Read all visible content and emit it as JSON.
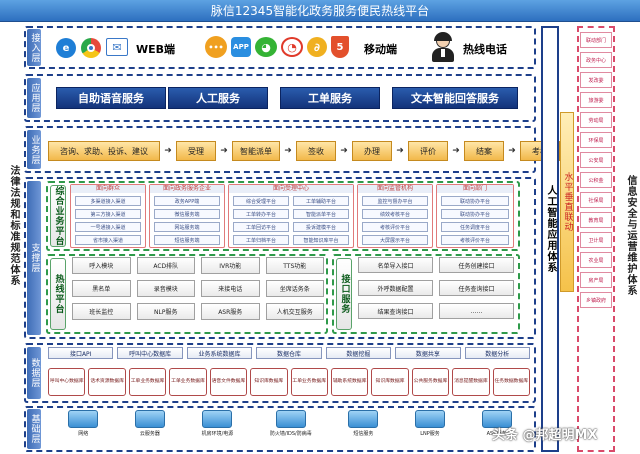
{
  "title": "脉信12345智能化政务服务便民热线平台",
  "left_side": "法律法规和标准规范体系",
  "right_side": "信息安全与运营维护体系",
  "layers": {
    "access": "接入层",
    "application": "应用层",
    "business": "业务层",
    "support": "支撑层",
    "data": "数据层",
    "base": "基础层"
  },
  "access": {
    "web_icons": [
      {
        "icon": "ie-icon",
        "color": "#1e7ed6",
        "glyph": "e"
      },
      {
        "icon": "chrome-icon",
        "color": "#e0a020",
        "glyph": "◉"
      },
      {
        "icon": "mail-icon",
        "color": "#3a78c8",
        "glyph": "✉"
      }
    ],
    "web_label": "WEB端",
    "mobile_icons": [
      {
        "icon": "chat-bubble-icon",
        "color": "#f0a020",
        "glyph": "•••"
      },
      {
        "icon": "app-icon",
        "color": "#2a8ee0",
        "glyph": "APP"
      },
      {
        "icon": "wechat-icon",
        "color": "#35b335",
        "glyph": "◕"
      },
      {
        "icon": "weibo-icon",
        "color": "#e03a2a",
        "glyph": "◔"
      },
      {
        "icon": "mini-program-icon",
        "color": "#f0b020",
        "glyph": "∂"
      },
      {
        "icon": "html5-icon",
        "color": "#e3502c",
        "glyph": "5"
      }
    ],
    "mobile_label": "移动端",
    "phone_icon": "agent-headset-icon",
    "phone_label": "热线电话"
  },
  "application": [
    "自助语音服务",
    "人工服务",
    "工单服务",
    "文本智能回答服务"
  ],
  "business": [
    "咨询、求助、投诉、建议",
    "受理",
    "智能派单",
    "签收",
    "办理",
    "评价",
    "结案",
    "考核"
  ],
  "support": {
    "comprehensive_label": "综合业务平台",
    "groups": [
      {
        "title": "面向群众",
        "items": [
          "多渠道接入渠道",
          "第三方接入渠道",
          "一号通接入渠道",
          "省市接入渠道"
        ]
      },
      {
        "title": "面向政务服务企业",
        "items": [
          "政务APP端",
          "微信服务端",
          "网站服务端",
          "短信服务端"
        ]
      },
      {
        "title": "面向受理中心",
        "items": [
          "综合受理平台",
          "工单转办平台",
          "工单回访平台",
          "工单归档平台",
          "工单辅助平台",
          "智能派单平台",
          "投诉建模平台",
          "智能知识库平台"
        ]
      },
      {
        "title": "面向监管机构",
        "items": [
          "监控与督办平台",
          "绩效考核平台",
          "考核评价平台",
          "大屏展示平台"
        ]
      },
      {
        "title": "面向部门",
        "items": [
          "联动协办平台",
          "联动协办平台",
          "任务调度平台",
          "考核评价平台"
        ]
      }
    ],
    "hotline_label": "热线平台",
    "hotline_cells": [
      "呼入模块",
      "ACD排队",
      "IVR功能",
      "TTS功能",
      "黑名单",
      "录音模块",
      "来接电话",
      "坐席话务条",
      "班长监控",
      "NLP服务",
      "ASR服务",
      "人机交互服务"
    ],
    "interface_label": "接口服务",
    "interface_cells": [
      "名单导入接口",
      "任务创建接口",
      "外呼数据配置",
      "任务查询接口",
      "结果查询接口",
      "……"
    ]
  },
  "data": {
    "top": [
      "接口API",
      "呼叫中心数据库",
      "业务系统数据库",
      "数据仓库",
      "数据挖掘",
      "数据共享",
      "数据分析"
    ],
    "dbs": [
      "呼叫中心数据库",
      "话术资源数据库",
      "工单业务数据库",
      "工单业务数据库",
      "语音文件数据库",
      "知识库数据库",
      "工单业务数据库",
      "辅助系统数据库",
      "知识库数据库",
      "公共服务数据库",
      "消息提醒数据库",
      "任务数据数据库"
    ]
  },
  "base": [
    "网络",
    "云服务器",
    "机房环境/电源",
    "防火墙/IDS/防病毒",
    "短信服务",
    "LNP服务",
    "ASR服务"
  ],
  "ai_label": "人工智能应用体系",
  "horizontal_label": "水平垂直联动",
  "departments": [
    "联动部门",
    "政务中心",
    "发改委",
    "旅游委",
    "劳动局",
    "环保局",
    "公安局",
    "公积金",
    "社保局",
    "教育局",
    "卫计局",
    "农业局",
    "房产局",
    "乡镇政府"
  ],
  "watermark": "头条 @邦超明MX"
}
